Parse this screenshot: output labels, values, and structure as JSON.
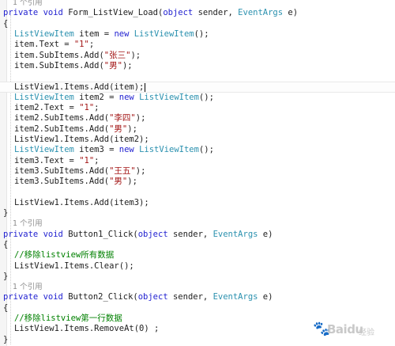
{
  "code": {
    "lines": [
      [
        {
          "t": "1 个引用",
          "c": "ref"
        }
      ],
      [
        {
          "t": "private",
          "c": "kw"
        },
        {
          "t": " "
        },
        {
          "t": "void",
          "c": "kw"
        },
        {
          "t": " Form_ListView_Load("
        },
        {
          "t": "object",
          "c": "kw"
        },
        {
          "t": " sender, "
        },
        {
          "t": "EventArgs",
          "c": "ty"
        },
        {
          "t": " e)"
        }
      ],
      [
        {
          "t": "{"
        }
      ],
      [
        {
          "t": "ListViewItem",
          "c": "ty"
        },
        {
          "t": " item = "
        },
        {
          "t": "new",
          "c": "kw"
        },
        {
          "t": " "
        },
        {
          "t": "ListViewItem",
          "c": "ty"
        },
        {
          "t": "();"
        }
      ],
      [
        {
          "t": "item.Text = "
        },
        {
          "t": "\"1\"",
          "c": "st"
        },
        {
          "t": ";"
        }
      ],
      [
        {
          "t": "item.SubItems.Add("
        },
        {
          "t": "\"张三\"",
          "c": "st"
        },
        {
          "t": ");"
        }
      ],
      [
        {
          "t": "item.SubItems.Add("
        },
        {
          "t": "\"男\"",
          "c": "st"
        },
        {
          "t": ");"
        }
      ],
      [],
      [
        {
          "t": "ListView1.Items.Add(item);"
        }
      ],
      [
        {
          "t": "ListViewItem",
          "c": "ty"
        },
        {
          "t": " item2 = "
        },
        {
          "t": "new",
          "c": "kw"
        },
        {
          "t": " "
        },
        {
          "t": "ListViewItem",
          "c": "ty"
        },
        {
          "t": "();"
        }
      ],
      [
        {
          "t": "item2.Text = "
        },
        {
          "t": "\"1\"",
          "c": "st"
        },
        {
          "t": ";"
        }
      ],
      [
        {
          "t": "item2.SubItems.Add("
        },
        {
          "t": "\"李四\"",
          "c": "st"
        },
        {
          "t": ");"
        }
      ],
      [
        {
          "t": "item2.SubItems.Add("
        },
        {
          "t": "\"男\"",
          "c": "st"
        },
        {
          "t": ");"
        }
      ],
      [
        {
          "t": "ListView1.Items.Add(item2);"
        }
      ],
      [
        {
          "t": "ListViewItem",
          "c": "ty"
        },
        {
          "t": " item3 = "
        },
        {
          "t": "new",
          "c": "kw"
        },
        {
          "t": " "
        },
        {
          "t": "ListViewItem",
          "c": "ty"
        },
        {
          "t": "();"
        }
      ],
      [
        {
          "t": "item3.Text = "
        },
        {
          "t": "\"1\"",
          "c": "st"
        },
        {
          "t": ";"
        }
      ],
      [
        {
          "t": "item3.SubItems.Add("
        },
        {
          "t": "\"王五\"",
          "c": "st"
        },
        {
          "t": ");"
        }
      ],
      [
        {
          "t": "item3.SubItems.Add("
        },
        {
          "t": "\"男\"",
          "c": "st"
        },
        {
          "t": ");"
        }
      ],
      [],
      [
        {
          "t": "ListView1.Items.Add(item3);"
        }
      ],
      [
        {
          "t": "}"
        }
      ],
      [
        {
          "t": "1 个引用",
          "c": "ref"
        }
      ],
      [
        {
          "t": "private",
          "c": "kw"
        },
        {
          "t": " "
        },
        {
          "t": "void",
          "c": "kw"
        },
        {
          "t": " Button1_Click("
        },
        {
          "t": "object",
          "c": "kw"
        },
        {
          "t": " sender, "
        },
        {
          "t": "EventArgs",
          "c": "ty"
        },
        {
          "t": " e)"
        }
      ],
      [
        {
          "t": "{"
        }
      ],
      [
        {
          "t": "//移除listview所有数据",
          "c": "cm"
        }
      ],
      [
        {
          "t": "ListView1.Items.Clear();"
        }
      ],
      [
        {
          "t": "}"
        }
      ],
      [
        {
          "t": "1 个引用",
          "c": "ref"
        }
      ],
      [
        {
          "t": "private",
          "c": "kw"
        },
        {
          "t": " "
        },
        {
          "t": "void",
          "c": "kw"
        },
        {
          "t": " Button2_Click("
        },
        {
          "t": "object",
          "c": "kw"
        },
        {
          "t": " sender, "
        },
        {
          "t": "EventArgs",
          "c": "ty"
        },
        {
          "t": " e)"
        }
      ],
      [
        {
          "t": "{"
        }
      ],
      [
        {
          "t": "//移除listview第一行数据",
          "c": "cm"
        }
      ],
      [
        {
          "t": "ListView1.Items.RemoveAt(0) ;"
        }
      ],
      [
        {
          "t": "}"
        }
      ]
    ]
  },
  "watermark": {
    "brand": "Baidu",
    "sub": "经验"
  },
  "colors": {
    "keyword": "#1f1fd0",
    "type": "#2b91af",
    "string": "#a31515",
    "comment": "#008000",
    "reference": "#8c8c8c"
  }
}
